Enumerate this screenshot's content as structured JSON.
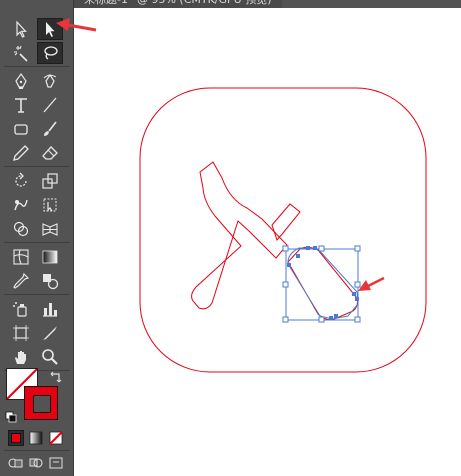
{
  "document_tab": {
    "title": "未标题-1* @ 95% (CMYK/GPU 预览)"
  },
  "toolbar": {
    "tools": [
      {
        "name": "selection-tool-icon"
      },
      {
        "name": "direct-selection-tool-icon",
        "selected": true
      },
      {
        "name": "magic-wand-tool-icon"
      },
      {
        "name": "lasso-tool-icon"
      },
      {
        "name": "pen-tool-icon"
      },
      {
        "name": "curvature-tool-icon"
      },
      {
        "name": "type-tool-icon"
      },
      {
        "name": "line-segment-tool-icon"
      },
      {
        "name": "rectangle-tool-icon"
      },
      {
        "name": "paintbrush-tool-icon"
      },
      {
        "name": "pencil-tool-icon"
      },
      {
        "name": "eraser-tool-icon"
      },
      {
        "name": "rotate-tool-icon"
      },
      {
        "name": "scale-tool-icon"
      },
      {
        "name": "warp-tool-icon"
      },
      {
        "name": "free-transform-tool-icon"
      },
      {
        "name": "shape-builder-tool-icon"
      },
      {
        "name": "perspective-grid-tool-icon"
      },
      {
        "name": "mesh-tool-icon"
      },
      {
        "name": "gradient-tool-icon"
      },
      {
        "name": "eyedropper-tool-icon"
      },
      {
        "name": "blend-tool-icon"
      },
      {
        "name": "symbol-sprayer-tool-icon"
      },
      {
        "name": "column-graph-tool-icon"
      },
      {
        "name": "artboard-tool-icon"
      },
      {
        "name": "slice-tool-icon"
      },
      {
        "name": "hand-tool-icon"
      },
      {
        "name": "zoom-tool-icon"
      }
    ]
  },
  "colors": {
    "fill": "none",
    "stroke": "#e60012",
    "selection": "#4a7bd4",
    "annotation_arrow": "#e8343a",
    "ui_panel": "#535353"
  }
}
